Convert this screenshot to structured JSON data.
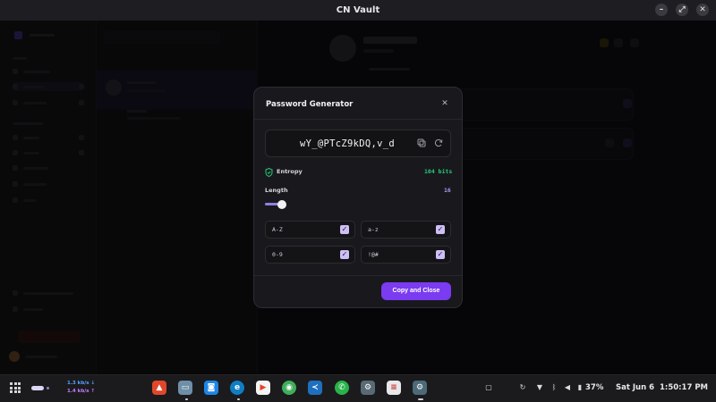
{
  "window": {
    "title": "CN Vault",
    "controls": [
      "minimize-icon",
      "restore-icon",
      "close-icon"
    ]
  },
  "modal": {
    "title": "Password Generator",
    "close_icon": "close-icon",
    "password": "wY_@PTcZ9kDQ,v_d",
    "copy_icon": "copy-icon",
    "regenerate_icon": "refresh-icon",
    "entropy_label": "Entropy",
    "entropy_value": "104 bits",
    "length_label": "Length",
    "length_value": "16",
    "options": [
      {
        "label": "A-Z",
        "checked": true
      },
      {
        "label": "a-z",
        "checked": true
      },
      {
        "label": "0-9",
        "checked": true
      },
      {
        "label": "!@#",
        "checked": true
      }
    ],
    "copy_close_label": "Copy and Close"
  },
  "colors": {
    "accent": "#7b3bf0",
    "entropy": "#27c97a",
    "length": "#a99bf0",
    "check": "#cdbff5"
  },
  "taskbar": {
    "net_down": "1.3 kb/s",
    "net_up": "1.4 kb/s",
    "apps": [
      "brave-icon",
      "files-icon",
      "store-icon",
      "edge-icon",
      "play-store-icon",
      "android-icon",
      "vscode-icon",
      "whatsapp-icon",
      "settings-icon",
      "document-icon",
      "cn-vault-icon"
    ],
    "battery": "37%",
    "date": "Sat Jun 6",
    "time": "1:50:17 PM"
  }
}
